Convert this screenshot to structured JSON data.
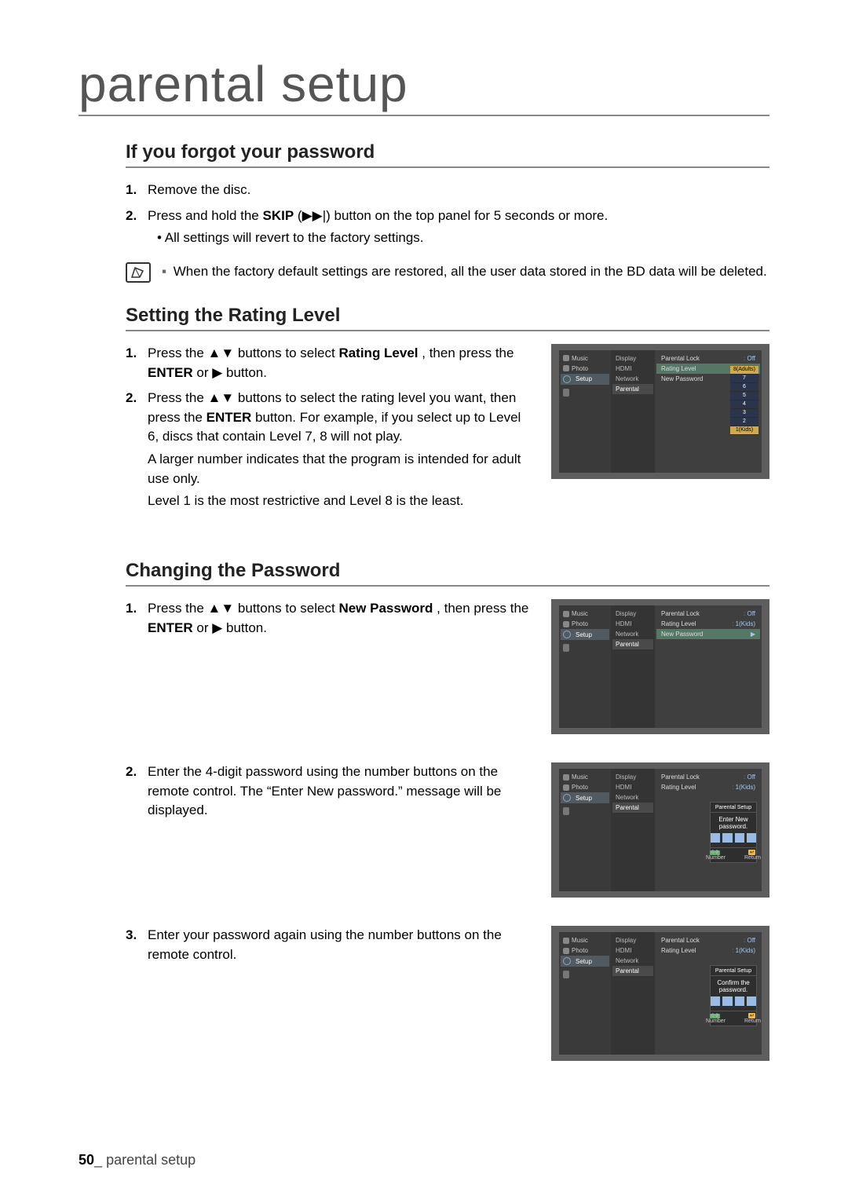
{
  "page_title": "parental setup",
  "footer": {
    "page": "50",
    "label": "parental setup",
    "sep": "_"
  },
  "section_forgot": {
    "title": "If you forgot your password",
    "steps": [
      {
        "n": "1.",
        "text": "Remove the disc."
      },
      {
        "n": "2.",
        "prefix": "Press and hold the ",
        "bold": "SKIP",
        "sym": " (▶▶|) ",
        "suffix": "button on the top panel for 5 seconds or more.",
        "bullet": "All settings will revert to the factory settings."
      }
    ],
    "note": "When the factory default settings are restored, all the user data stored in the BD data will be deleted."
  },
  "section_rating": {
    "title": "Setting the Rating Level",
    "steps": [
      {
        "n": "1.",
        "prefix": "Press the ▲▼ buttons to select ",
        "bold": "Rating Level",
        "mid": ", then press the ",
        "bold2": "ENTER",
        "suffix": " or ▶ button."
      },
      {
        "n": "2.",
        "prefix": "Press the ▲▼ buttons to select the rating level you want, then press the ",
        "bold": "ENTER",
        "suffix": " button. For example, if you select up to Level 6, discs that contain Level 7, 8 will not play.",
        "extra1": "A larger number indicates that the program is intended for adult use only.",
        "extra2": "Level 1 is the most restrictive and Level 8 is the least."
      }
    ],
    "screenshot": {
      "left": [
        "Music",
        "Photo",
        "Setup"
      ],
      "mid": [
        "Display",
        "HDMI",
        "Network",
        "Parental"
      ],
      "opts": [
        {
          "k": "Parental Lock",
          "v": "Off"
        },
        {
          "k": "Rating Level",
          "v": ""
        },
        {
          "k": "New Password",
          "v": ""
        }
      ],
      "dropdown": [
        "8(Adults)",
        "7",
        "6",
        "5",
        "4",
        "3",
        "2",
        "1(Kids)"
      ],
      "dropdown_hl": 0
    }
  },
  "section_change": {
    "title": "Changing the Password",
    "steps": [
      {
        "n": "1.",
        "prefix": "Press the ▲▼ buttons to select ",
        "bold": "New Password",
        "mid": ", then press the ",
        "bold2": "ENTER",
        "suffix": " or ▶ button."
      },
      {
        "n": "2.",
        "text": "Enter the 4-digit password using the number buttons on the remote control. The “Enter New password.” message will be displayed."
      },
      {
        "n": "3.",
        "text": "Enter your password again using the number buttons on the remote control."
      }
    ],
    "screenshot1": {
      "opts": [
        {
          "k": "Parental Lock",
          "v": "Off"
        },
        {
          "k": "Rating Level",
          "v": "1(Kids)"
        },
        {
          "k": "New Password",
          "v": "-"
        }
      ]
    },
    "screenshot2": {
      "dialog_title": "Parental Setup",
      "dialog_msg": "Enter New password.",
      "number": "Number",
      "return": "Return",
      "behind": [
        {
          "k": "Parental Lock",
          "v": "Off"
        },
        {
          "k": "Rating Level",
          "v": "1(Kids)"
        }
      ]
    },
    "screenshot3": {
      "dialog_title": "Parental Setup",
      "dialog_msg": "Confirm the password.",
      "number": "Number",
      "return": "Return",
      "behind": [
        {
          "k": "Parental Lock",
          "v": "Off"
        },
        {
          "k": "Rating Level",
          "v": "1(Kids)"
        }
      ]
    },
    "common_left": [
      "Music",
      "Photo",
      "Setup"
    ],
    "common_mid": [
      "Display",
      "HDMI",
      "Network",
      "Parental"
    ]
  }
}
